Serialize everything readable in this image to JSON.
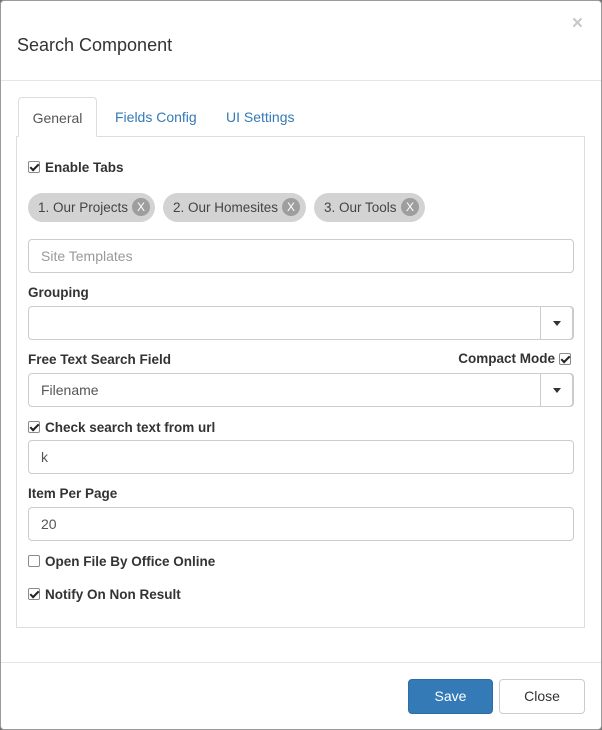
{
  "dialog": {
    "title": "Search Component",
    "close_glyph": "×"
  },
  "tabs": [
    {
      "label": "General"
    },
    {
      "label": "Fields Config"
    },
    {
      "label": "UI Settings"
    }
  ],
  "general": {
    "enable_tabs": {
      "label": "Enable Tabs",
      "checked": true
    },
    "tab_chips": [
      {
        "label": "1. Our Projects",
        "remove": "X"
      },
      {
        "label": "2. Our Homesites",
        "remove": "X"
      },
      {
        "label": "3. Our Tools",
        "remove": "X"
      }
    ],
    "site_templates": {
      "value": "",
      "placeholder": "Site Templates"
    },
    "grouping": {
      "label": "Grouping",
      "value": ""
    },
    "free_text": {
      "label": "Free Text Search Field",
      "value": "Filename"
    },
    "compact_mode": {
      "label": "Compact Mode",
      "checked": true
    },
    "check_url": {
      "label": "Check search text from url",
      "checked": true,
      "value": "k"
    },
    "item_per_page": {
      "label": "Item Per Page",
      "value": "20"
    },
    "open_office": {
      "label": "Open File By Office Online",
      "checked": false
    },
    "notify": {
      "label": "Notify On Non Result",
      "checked": true
    }
  },
  "footer": {
    "save_label": "Save",
    "close_label": "Close"
  },
  "colors": {
    "primary": "#337ab7",
    "link": "#337ab7",
    "chip_bg": "#d3d3d3"
  }
}
